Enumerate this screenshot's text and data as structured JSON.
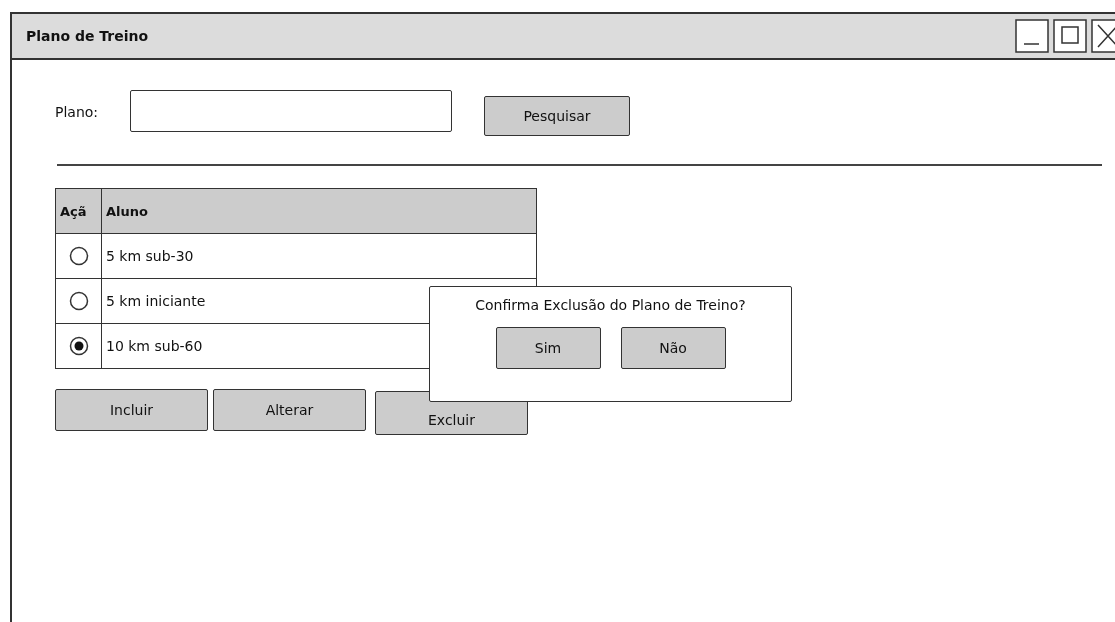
{
  "window": {
    "title": "Plano de Treino"
  },
  "search": {
    "label": "Plano:",
    "button": "Pesquisar"
  },
  "table": {
    "columns": [
      "Açã",
      "Aluno"
    ],
    "rows": [
      {
        "name": "5 km sub-30",
        "selected": false
      },
      {
        "name": "5 km iniciante",
        "selected": false
      },
      {
        "name": "10 km sub-60",
        "selected": true
      }
    ]
  },
  "buttons": [
    "Incluir",
    "Alterar",
    "Excluir"
  ],
  "dialog": {
    "message": "Confirma Exclusão do Plano de Treino?",
    "buttons": [
      "Sim",
      "Não"
    ]
  }
}
